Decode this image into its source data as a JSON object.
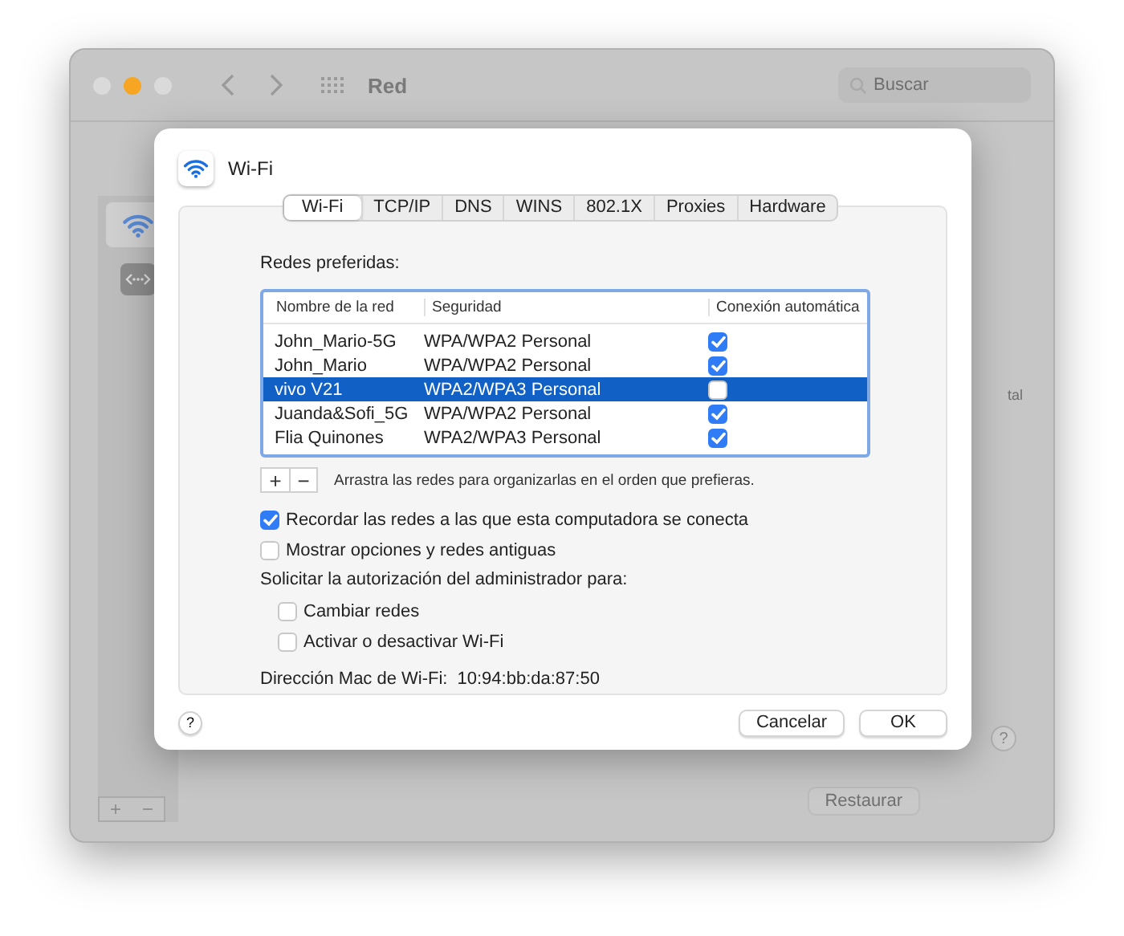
{
  "window": {
    "title": "Red",
    "traffic_lights": [
      {
        "color": "#dadada"
      },
      {
        "color": "#f6a623"
      },
      {
        "color": "#dadada"
      }
    ],
    "search": {
      "placeholder": "Buscar"
    },
    "sidebar": {
      "items": [
        {
          "kind": "wifi",
          "selected": true
        },
        {
          "kind": "bridge",
          "selected": false
        }
      ]
    },
    "sidebar_buttons": [
      "+",
      "−"
    ],
    "side_text": "tal",
    "help": "?",
    "buttons": [
      "Restaurar"
    ]
  },
  "dialog": {
    "title": "Wi-Fi",
    "tabs": [
      {
        "label": "Wi-Fi",
        "selected": true
      },
      {
        "label": "TCP/IP",
        "selected": false
      },
      {
        "label": "DNS",
        "selected": false
      },
      {
        "label": "WINS",
        "selected": false
      },
      {
        "label": "802.1X",
        "selected": false
      },
      {
        "label": "Proxies",
        "selected": false
      },
      {
        "label": "Hardware",
        "selected": false
      }
    ],
    "section_label": "Redes preferidas:",
    "table": {
      "columns": [
        "Nombre de la red",
        "Seguridad",
        "Conexión automática"
      ],
      "rows": [
        {
          "name": "John_Mario-5G",
          "security": "WPA/WPA2 Personal",
          "auto": true,
          "selected": false
        },
        {
          "name": "John_Mario",
          "security": "WPA/WPA2 Personal",
          "auto": true,
          "selected": false
        },
        {
          "name": "vivo V21",
          "security": "WPA2/WPA3 Personal",
          "auto": false,
          "selected": true
        },
        {
          "name": "Juanda&Sofi_5G",
          "security": "WPA/WPA2 Personal",
          "auto": true,
          "selected": false
        },
        {
          "name": "Flia Quinones",
          "security": "WPA2/WPA3 Personal",
          "auto": true,
          "selected": false
        }
      ]
    },
    "list_buttons": [
      "+",
      "−"
    ],
    "drag_hint": "Arrastra las redes para organizarlas en el orden que prefieras.",
    "options": [
      {
        "label": "Recordar las redes a las que esta computadora se conecta",
        "checked": true
      },
      {
        "label": "Mostrar opciones y redes antiguas",
        "checked": false
      }
    ],
    "admin_label": "Solicitar la autorización del administrador para:",
    "admin_options": [
      {
        "label": "Cambiar redes",
        "checked": false
      },
      {
        "label": "Activar o desactivar Wi-Fi",
        "checked": false
      }
    ],
    "mac_label": "Dirección Mac de Wi-Fi:",
    "mac_value": "10:94:bb:da:87:50",
    "help": "?",
    "buttons": [
      {
        "label": "Cancelar",
        "kind": "secondary"
      },
      {
        "label": "OK",
        "kind": "default"
      }
    ]
  }
}
